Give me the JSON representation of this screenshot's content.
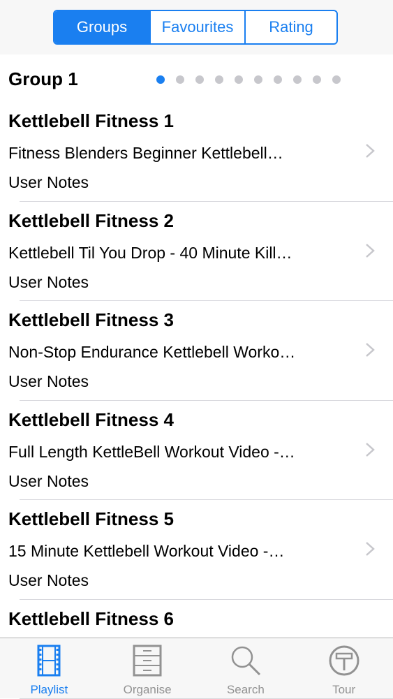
{
  "segments": {
    "items": [
      {
        "label": "Groups",
        "active": true
      },
      {
        "label": "Favourites",
        "active": false
      },
      {
        "label": "Rating",
        "active": false
      }
    ]
  },
  "group": {
    "title": "Group 1",
    "page_count": 10,
    "current_page": 1
  },
  "rows": [
    {
      "title": "Kettlebell Fitness 1",
      "subtitle": "Fitness Blenders Beginner Kettlebell…",
      "notes": "User Notes"
    },
    {
      "title": "Kettlebell Fitness 2",
      "subtitle": "Kettlebell Til You Drop - 40 Minute Kill…",
      "notes": "User Notes"
    },
    {
      "title": "Kettlebell Fitness 3",
      "subtitle": "Non-Stop Endurance Kettlebell Worko…",
      "notes": "User Notes"
    },
    {
      "title": "Kettlebell Fitness 4",
      "subtitle": "Full Length KettleBell Workout Video -…",
      "notes": "User Notes"
    },
    {
      "title": "Kettlebell Fitness 5",
      "subtitle": "15 Minute Kettlebell Workout Video -…",
      "notes": "User Notes"
    },
    {
      "title": "Kettlebell Fitness 6",
      "subtitle": "",
      "notes": ""
    }
  ],
  "tabs": {
    "items": [
      {
        "label": "Playlist",
        "icon": "film-strip-icon",
        "active": true
      },
      {
        "label": "Organise",
        "icon": "cabinet-icon",
        "active": false
      },
      {
        "label": "Search",
        "icon": "magnifier-icon",
        "active": false
      },
      {
        "label": "Tour",
        "icon": "tour-sign-icon",
        "active": false
      }
    ]
  },
  "colors": {
    "accent": "#1a7ff0",
    "inactive": "#929292",
    "separator": "#d9d9de"
  }
}
